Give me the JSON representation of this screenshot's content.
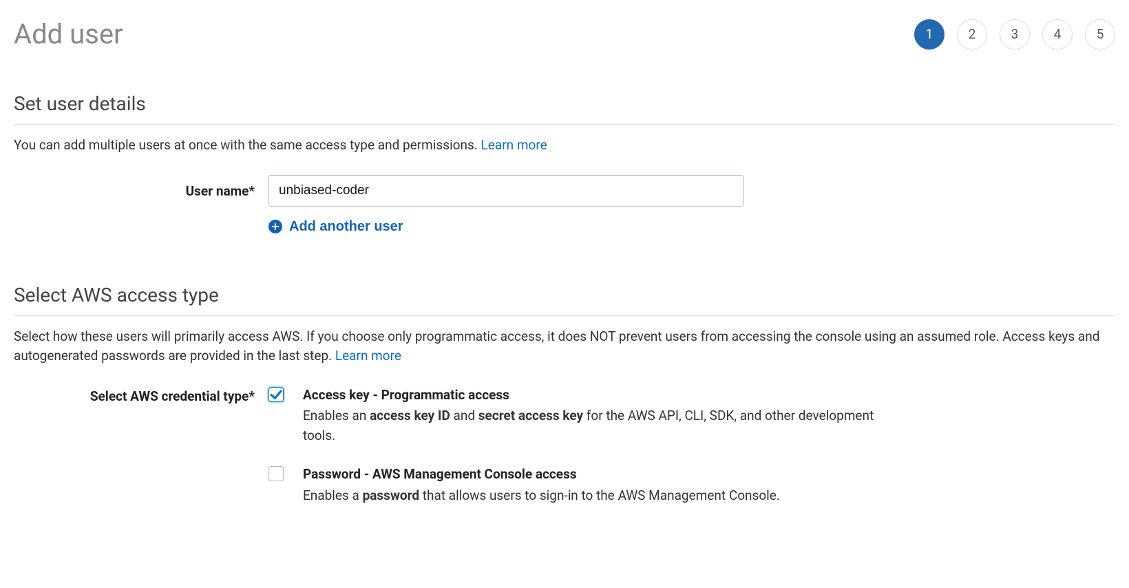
{
  "page": {
    "title": "Add user"
  },
  "steps": {
    "current": 1,
    "items": [
      "1",
      "2",
      "3",
      "4",
      "5"
    ]
  },
  "section_details": {
    "title": "Set user details",
    "desc": "You can add multiple users at once with the same access type and permissions. ",
    "learn_more": "Learn more",
    "user_name_label": "User name*",
    "user_name_value": "unbiased-coder",
    "add_another_label": "Add another user"
  },
  "section_access": {
    "title": "Select AWS access type",
    "desc": "Select how these users will primarily access AWS. If you choose only programmatic access, it does NOT prevent users from accessing the console using an assumed role. Access keys and autogenerated passwords are provided in the last step. ",
    "learn_more": "Learn more",
    "credential_label": "Select AWS credential type*",
    "option1": {
      "title": "Access key - Programmatic access",
      "desc_pre": "Enables an ",
      "bold1": "access key ID",
      "desc_mid": " and ",
      "bold2": "secret access key",
      "desc_post": " for the AWS API, CLI, SDK, and other development tools.",
      "checked": true
    },
    "option2": {
      "title": "Password - AWS Management Console access",
      "desc_pre": "Enables a ",
      "bold1": "password",
      "desc_post": " that allows users to sign-in to the AWS Management Console.",
      "checked": false
    }
  }
}
